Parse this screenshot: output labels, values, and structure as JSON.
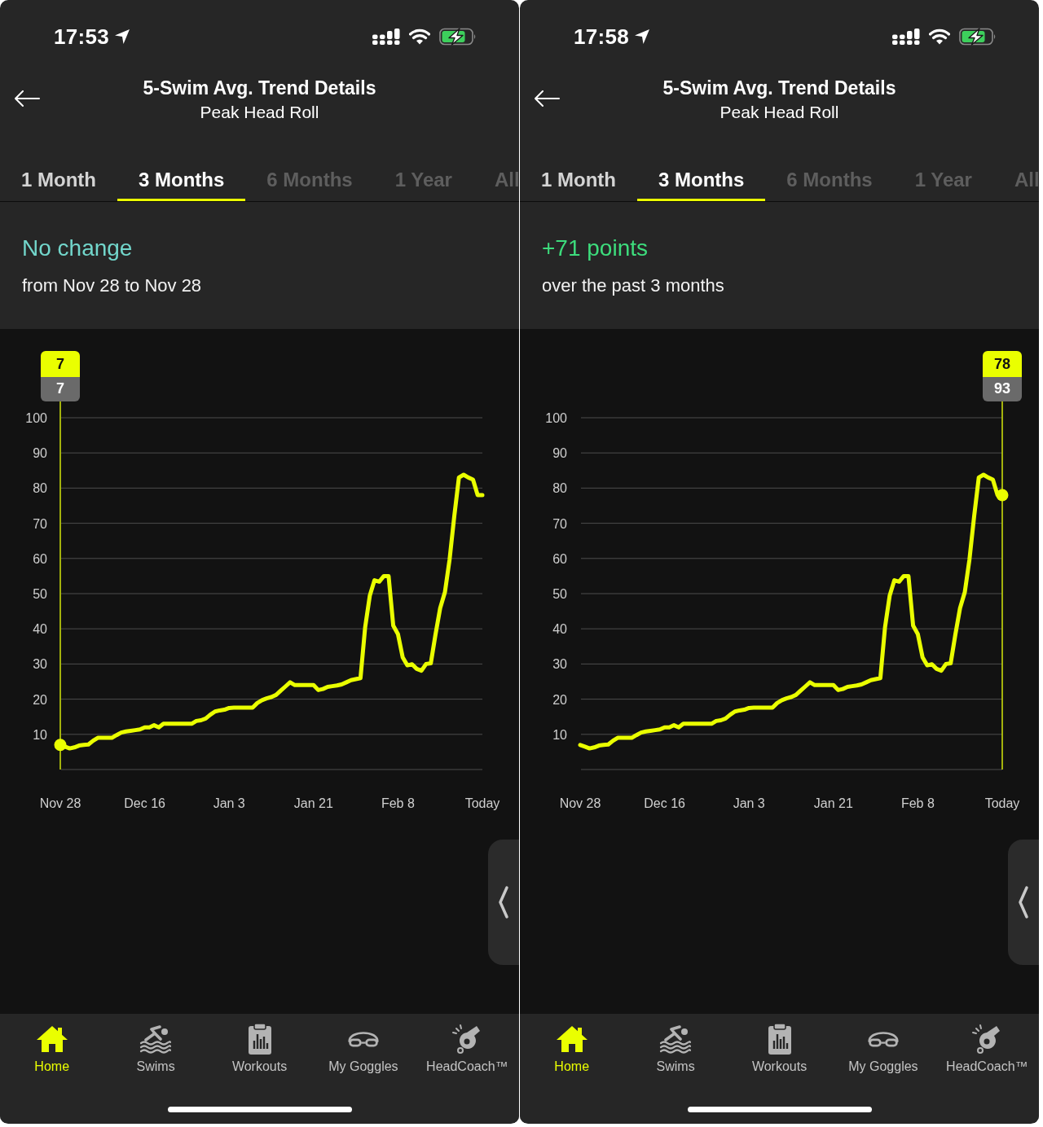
{
  "screens": [
    {
      "status_bar": {
        "time": "17:53"
      },
      "header": {
        "title": "5-Swim Avg. Trend Details",
        "subtitle": "Peak Head Roll"
      },
      "tabs": [
        {
          "label": "1 Month",
          "selected": false,
          "disabled": false
        },
        {
          "label": "3 Months",
          "selected": true,
          "disabled": false
        },
        {
          "label": "6 Months",
          "selected": false,
          "disabled": true
        },
        {
          "label": "1 Year",
          "selected": false,
          "disabled": true
        },
        {
          "label": "All",
          "selected": false,
          "disabled": true
        }
      ],
      "summary": {
        "kind": "no_change",
        "headline": "No change",
        "detail": "from Nov 28 to Nov 28"
      },
      "chart": {
        "tooltip": {
          "kind": "start",
          "value": "7",
          "secondary_value": "7"
        },
        "chart_data": {
          "type": "line",
          "grid": true,
          "ylim": [
            0,
            100
          ],
          "yticks": [
            10,
            20,
            30,
            40,
            50,
            60,
            70,
            80,
            90,
            100
          ],
          "categories": [
            "Nov 28",
            null,
            null,
            null,
            null,
            null,
            null,
            null,
            null,
            null,
            null,
            null,
            null,
            null,
            null,
            null,
            null,
            null,
            "Dec 16",
            null,
            null,
            null,
            null,
            null,
            null,
            null,
            null,
            null,
            null,
            null,
            null,
            null,
            null,
            null,
            null,
            null,
            "Jan 3",
            null,
            null,
            null,
            null,
            null,
            null,
            null,
            null,
            null,
            null,
            null,
            null,
            null,
            null,
            null,
            null,
            null,
            "Jan 21",
            null,
            null,
            null,
            null,
            null,
            null,
            null,
            null,
            null,
            null,
            null,
            null,
            null,
            null,
            null,
            null,
            null,
            "Feb 8",
            null,
            null,
            null,
            null,
            null,
            null,
            null,
            null,
            null,
            null,
            null,
            null,
            null,
            null,
            null,
            null,
            null,
            "Today"
          ],
          "values": [
            7,
            6.5,
            6,
            6.3,
            6.8,
            7,
            7.1,
            8.2,
            9,
            9,
            9,
            9,
            9.8,
            10.5,
            10.8,
            11,
            11.2,
            11.4,
            12,
            12,
            12.6,
            12,
            13,
            13,
            13,
            13,
            13,
            13,
            13,
            13.8,
            14,
            14.5,
            15.6,
            16.5,
            16.8,
            17,
            17.5,
            17.6,
            17.6,
            17.6,
            17.6,
            17.6,
            18.9,
            19.7,
            20.2,
            20.6,
            21.2,
            22.4,
            23.6,
            24.8,
            24,
            24,
            24,
            24,
            24,
            22.6,
            22.9,
            23.5,
            23.7,
            23.9,
            24.2,
            24.8,
            25.4,
            25.7,
            26,
            40.4,
            49.5,
            53.8,
            53.4,
            55,
            55,
            40.9,
            38.5,
            31.9,
            29.6,
            29.9,
            28.6,
            28.1,
            30,
            30.2,
            38.3,
            45.9,
            50.4,
            59.6,
            72,
            83,
            83.8,
            83,
            82.4,
            78,
            78
          ]
        }
      },
      "tab_bar": {
        "items": [
          {
            "label": "Home",
            "selected": true
          },
          {
            "label": "Swims",
            "selected": false
          },
          {
            "label": "Workouts",
            "selected": false
          },
          {
            "label": "My Goggles",
            "selected": false
          },
          {
            "label": "HeadCoach™",
            "selected": false
          }
        ]
      }
    },
    {
      "status_bar": {
        "time": "17:58"
      },
      "header": {
        "title": "5-Swim Avg. Trend Details",
        "subtitle": "Peak Head Roll"
      },
      "tabs": [
        {
          "label": "1 Month",
          "selected": false,
          "disabled": false
        },
        {
          "label": "3 Months",
          "selected": true,
          "disabled": false
        },
        {
          "label": "6 Months",
          "selected": false,
          "disabled": true
        },
        {
          "label": "1 Year",
          "selected": false,
          "disabled": true
        },
        {
          "label": "All",
          "selected": false,
          "disabled": true
        }
      ],
      "summary": {
        "kind": "increase",
        "headline": "+71 points",
        "detail": "over the past 3 months"
      },
      "chart": {
        "tooltip": {
          "kind": "end",
          "value": "78",
          "secondary_value": "93"
        },
        "chart_data": {
          "type": "line",
          "grid": true,
          "ylim": [
            0,
            100
          ],
          "yticks": [
            10,
            20,
            30,
            40,
            50,
            60,
            70,
            80,
            90,
            100
          ],
          "categories": [
            "Nov 28",
            null,
            null,
            null,
            null,
            null,
            null,
            null,
            null,
            null,
            null,
            null,
            null,
            null,
            null,
            null,
            null,
            null,
            "Dec 16",
            null,
            null,
            null,
            null,
            null,
            null,
            null,
            null,
            null,
            null,
            null,
            null,
            null,
            null,
            null,
            null,
            null,
            "Jan 3",
            null,
            null,
            null,
            null,
            null,
            null,
            null,
            null,
            null,
            null,
            null,
            null,
            null,
            null,
            null,
            null,
            null,
            "Jan 21",
            null,
            null,
            null,
            null,
            null,
            null,
            null,
            null,
            null,
            null,
            null,
            null,
            null,
            null,
            null,
            null,
            null,
            "Feb 8",
            null,
            null,
            null,
            null,
            null,
            null,
            null,
            null,
            null,
            null,
            null,
            null,
            null,
            null,
            null,
            null,
            null,
            "Today"
          ],
          "values": [
            7,
            6.5,
            6,
            6.3,
            6.8,
            7,
            7.1,
            8.2,
            9,
            9,
            9,
            9,
            9.8,
            10.5,
            10.8,
            11,
            11.2,
            11.4,
            12,
            12,
            12.6,
            12,
            13,
            13,
            13,
            13,
            13,
            13,
            13,
            13.8,
            14,
            14.5,
            15.6,
            16.5,
            16.8,
            17,
            17.5,
            17.6,
            17.6,
            17.6,
            17.6,
            17.6,
            18.9,
            19.7,
            20.2,
            20.6,
            21.2,
            22.4,
            23.6,
            24.8,
            24,
            24,
            24,
            24,
            24,
            22.6,
            22.9,
            23.5,
            23.7,
            23.9,
            24.2,
            24.8,
            25.4,
            25.7,
            26,
            40.4,
            49.5,
            53.8,
            53.4,
            55,
            55,
            40.9,
            38.5,
            31.9,
            29.6,
            29.9,
            28.6,
            28.1,
            30,
            30.2,
            38.3,
            45.9,
            50.4,
            59.6,
            72,
            83,
            83.8,
            83,
            82.4,
            78,
            78
          ]
        }
      },
      "tab_bar": {
        "items": [
          {
            "label": "Home",
            "selected": true
          },
          {
            "label": "Swims",
            "selected": false
          },
          {
            "label": "Workouts",
            "selected": false
          },
          {
            "label": "My Goggles",
            "selected": false
          },
          {
            "label": "HeadCoach™",
            "selected": false
          }
        ]
      }
    }
  ]
}
